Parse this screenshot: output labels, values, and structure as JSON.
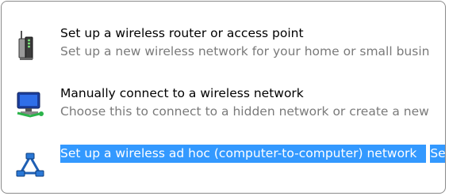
{
  "options": [
    {
      "title": "Set up a wireless router or access point",
      "description": "Set up a new wireless network for your home or small busin",
      "icon": "wireless-router-icon",
      "selected": false
    },
    {
      "title": "Manually connect to a wireless network",
      "description": "Choose this to connect to a hidden network or create a new",
      "icon": "network-computer-icon",
      "selected": false
    },
    {
      "title": "Set up a wireless ad hoc (computer-to-computer) network",
      "description": "Set up a temporary network for sharing files or an Internet c",
      "icon": "ad-hoc-network-icon",
      "selected": true
    }
  ],
  "colors": {
    "selection": "#3399ff",
    "description_text": "#7a7a7a",
    "border": "#8a8a8a"
  }
}
